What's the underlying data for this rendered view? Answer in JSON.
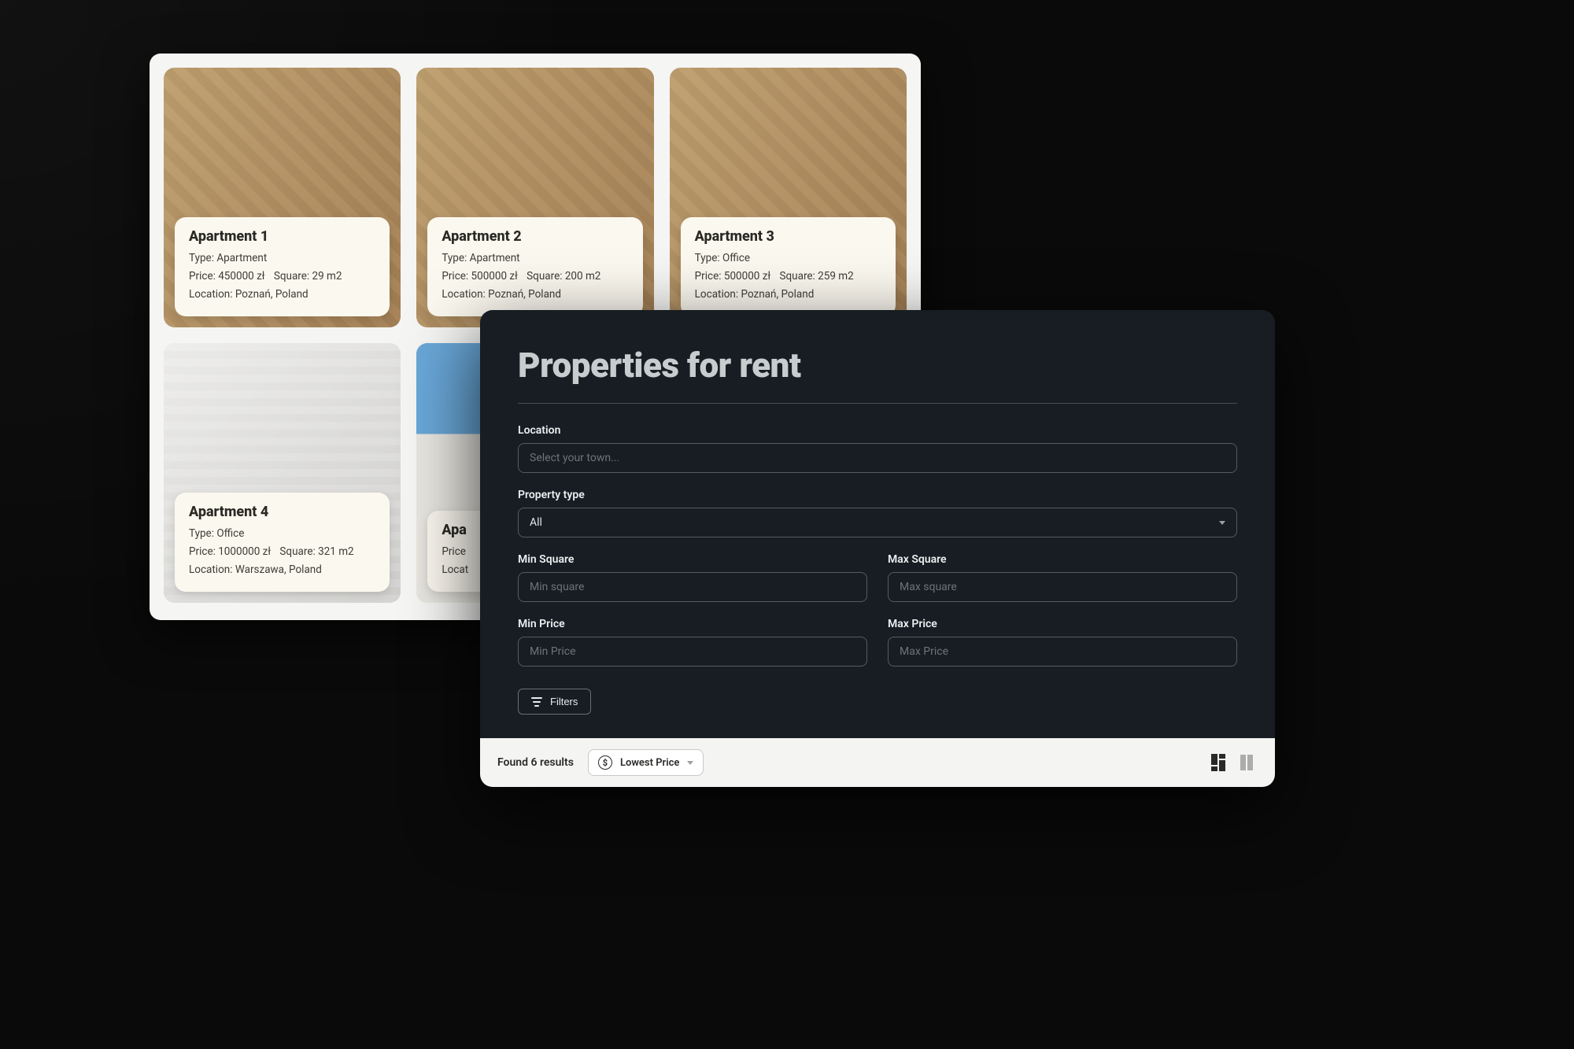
{
  "listings": {
    "items": [
      {
        "title": "Apartment 1",
        "type_label": "Type: Apartment",
        "price_label": "Price: 450000 zł",
        "square_label": "Square: 29 m2",
        "location_label": "Location: Poznań, Poland",
        "image_class": "img-warm-living"
      },
      {
        "title": "Apartment 2",
        "type_label": "Type: Apartment",
        "price_label": "Price: 500000 zł",
        "square_label": "Square: 200 m2",
        "location_label": "Location: Poznań, Poland",
        "image_class": "img-warm-living"
      },
      {
        "title": "Apartment 3",
        "type_label": "Type: Office",
        "price_label": "Price: 500000 zł",
        "square_label": "Square: 259 m2",
        "location_label": "Location: Poznań, Poland",
        "image_class": "img-warm-living"
      },
      {
        "title": "Apartment 4",
        "type_label": "Type: Office",
        "price_label": "Price: 1000000 zł",
        "square_label": "Square: 321 m2",
        "location_label": "Location: Warszawa, Poland",
        "image_class": "img-bright-room"
      },
      {
        "title": "Apa",
        "type_label": "",
        "price_label": "Price",
        "square_label": "",
        "location_label": "Locat",
        "image_class": "img-exterior"
      },
      {
        "title": "",
        "type_label": "",
        "price_label": "",
        "square_label": "",
        "location_label": "",
        "image_class": "img-warm-living"
      }
    ]
  },
  "search": {
    "title": "Properties for rent",
    "location_label": "Location",
    "location_placeholder": "Select your town...",
    "property_type_label": "Property type",
    "property_type_value": "All",
    "min_square_label": "Min Square",
    "min_square_placeholder": "Min square",
    "max_square_label": "Max Square",
    "max_square_placeholder": "Max square",
    "min_price_label": "Min Price",
    "min_price_placeholder": "Min Price",
    "max_price_label": "Max Price",
    "max_price_placeholder": "Max Price",
    "filters_label": "Filters"
  },
  "results": {
    "found_text": "Found 6 results",
    "sort_label": "Lowest Price",
    "currency_symbol": "$"
  }
}
